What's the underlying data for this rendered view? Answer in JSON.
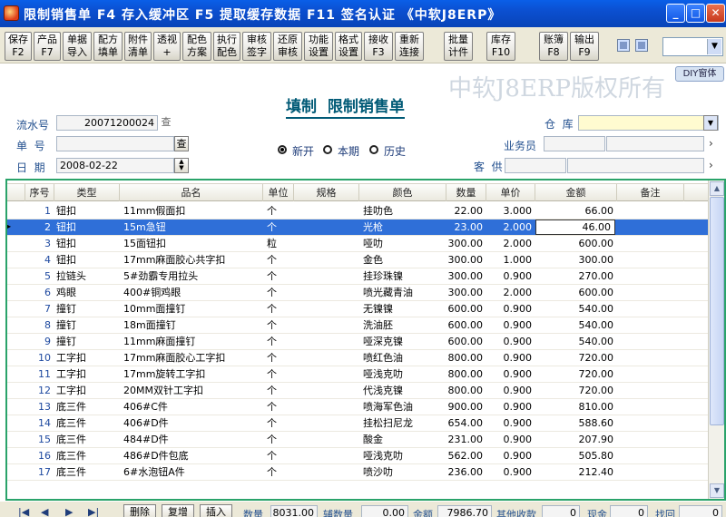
{
  "window": {
    "title": "限制销售单  F4 存入缓冲区  F5 提取缓存数据  F11 签名认证  《中软J8ERP》",
    "min_label": "_",
    "max_label": "□",
    "close_label": "✕"
  },
  "toolbar": {
    "buttons": [
      {
        "name": "save",
        "label": "保存\nF2"
      },
      {
        "name": "product",
        "label": "产品\nF7"
      },
      {
        "name": "doc-import",
        "label": "单据\n导入"
      },
      {
        "name": "fill-color",
        "label": "配方\n填单"
      },
      {
        "name": "attachment",
        "label": "附件\n清单"
      },
      {
        "name": "perspective",
        "label": "透视\n+"
      },
      {
        "name": "color-scheme",
        "label": "配色\n方案"
      },
      {
        "name": "execute-color",
        "label": "执行\n配色"
      },
      {
        "name": "review-sign",
        "label": "审核\n签字"
      },
      {
        "name": "restore-review",
        "label": "还原\n审核"
      },
      {
        "name": "function-settings",
        "label": "功能\n设置"
      },
      {
        "name": "format-settings",
        "label": "格式\n设置"
      },
      {
        "name": "receive",
        "label": "接收\nF3"
      },
      {
        "name": "reconnect",
        "label": "重新\n连接"
      },
      {
        "name": "batch-count",
        "label": "批量\n计件"
      },
      {
        "name": "stock",
        "label": "库存\nF10"
      },
      {
        "name": "ledger",
        "label": "账簿\nF8"
      },
      {
        "name": "export",
        "label": "输出\nF9"
      }
    ],
    "select_value": ""
  },
  "header": {
    "watermark": "中软J8ERP版权所有",
    "diy_label": "DIY窗体",
    "form_title": "填制  限制销售单",
    "serial_label": "流水号",
    "serial_value": "20071200024",
    "serial_btn": "查",
    "docno_label": "单  号",
    "docno_value": "",
    "docno_btn": "查",
    "date_label": "日  期",
    "date_value": "2008-02-22",
    "radio_new": "新开",
    "radio_period": "本期",
    "radio_history": "历史",
    "warehouse_label": "仓  库",
    "warehouse_value": "",
    "salesman_label": "业务员",
    "customer_label": "客  供"
  },
  "grid": {
    "columns": [
      "序号",
      "类型",
      "品名",
      "单位",
      "规格",
      "颜色",
      "数量",
      "单价",
      "金额",
      "备注"
    ],
    "rows": [
      {
        "idx": "1",
        "type": "钮扣",
        "name": "11mm假面扣",
        "unit": "个",
        "spec": "",
        "color": "挂叻色",
        "qty": "22.00",
        "price": "3.000",
        "amount": "66.00",
        "note": ""
      },
      {
        "idx": "2",
        "type": "钮扣",
        "name": "15m急钮",
        "unit": "个",
        "spec": "",
        "color": "光枪",
        "qty": "23.00",
        "price": "2.000",
        "amount": "46.00",
        "note": ""
      },
      {
        "idx": "3",
        "type": "钮扣",
        "name": "15面钮扣",
        "unit": "粒",
        "spec": "",
        "color": "哑叻",
        "qty": "300.00",
        "price": "2.000",
        "amount": "600.00",
        "note": ""
      },
      {
        "idx": "4",
        "type": "钮扣",
        "name": "17mm麻面胶心共字扣",
        "unit": "个",
        "spec": "",
        "color": "金色",
        "qty": "300.00",
        "price": "1.000",
        "amount": "300.00",
        "note": ""
      },
      {
        "idx": "5",
        "type": "拉链头",
        "name": "5#劲霸专用拉头",
        "unit": "个",
        "spec": "",
        "color": "挂珍珠镍",
        "qty": "300.00",
        "price": "0.900",
        "amount": "270.00",
        "note": ""
      },
      {
        "idx": "6",
        "type": "鸡眼",
        "name": "400#铜鸡眼",
        "unit": "个",
        "spec": "",
        "color": "喷光藏青油",
        "qty": "300.00",
        "price": "2.000",
        "amount": "600.00",
        "note": ""
      },
      {
        "idx": "7",
        "type": "撞钉",
        "name": "10mm面撞钉",
        "unit": "个",
        "spec": "",
        "color": "无镍镍",
        "qty": "600.00",
        "price": "0.900",
        "amount": "540.00",
        "note": ""
      },
      {
        "idx": "8",
        "type": "撞钉",
        "name": "18m面撞钉",
        "unit": "个",
        "spec": "",
        "color": "洗油胚",
        "qty": "600.00",
        "price": "0.900",
        "amount": "540.00",
        "note": ""
      },
      {
        "idx": "9",
        "type": "撞钉",
        "name": "11mm麻面撞钉",
        "unit": "个",
        "spec": "",
        "color": "哑深克镍",
        "qty": "600.00",
        "price": "0.900",
        "amount": "540.00",
        "note": ""
      },
      {
        "idx": "10",
        "type": "工字扣",
        "name": "17mm麻面胶心工字扣",
        "unit": "个",
        "spec": "",
        "color": "喷红色油",
        "qty": "800.00",
        "price": "0.900",
        "amount": "720.00",
        "note": ""
      },
      {
        "idx": "11",
        "type": "工字扣",
        "name": "17mm旋转工字扣",
        "unit": "个",
        "spec": "",
        "color": "哑浅克叻",
        "qty": "800.00",
        "price": "0.900",
        "amount": "720.00",
        "note": ""
      },
      {
        "idx": "12",
        "type": "工字扣",
        "name": "20MM双针工字扣",
        "unit": "个",
        "spec": "",
        "color": "代浅克镍",
        "qty": "800.00",
        "price": "0.900",
        "amount": "720.00",
        "note": ""
      },
      {
        "idx": "13",
        "type": "底三件",
        "name": "406#C件",
        "unit": "个",
        "spec": "",
        "color": "喷海军色油",
        "qty": "900.00",
        "price": "0.900",
        "amount": "810.00",
        "note": ""
      },
      {
        "idx": "14",
        "type": "底三件",
        "name": "406#D件",
        "unit": "个",
        "spec": "",
        "color": "挂松扫尼龙",
        "qty": "654.00",
        "price": "0.900",
        "amount": "588.60",
        "note": ""
      },
      {
        "idx": "15",
        "type": "底三件",
        "name": "484#D件",
        "unit": "个",
        "spec": "",
        "color": "酸金",
        "qty": "231.00",
        "price": "0.900",
        "amount": "207.90",
        "note": ""
      },
      {
        "idx": "16",
        "type": "底三件",
        "name": "486#D件包底",
        "unit": "个",
        "spec": "",
        "color": "哑浅克叻",
        "qty": "562.00",
        "price": "0.900",
        "amount": "505.80",
        "note": ""
      },
      {
        "idx": "17",
        "type": "底三件",
        "name": "6#水泡钮A件",
        "unit": "个",
        "spec": "",
        "color": "喷沙叻",
        "qty": "236.00",
        "price": "0.900",
        "amount": "212.40",
        "note": ""
      }
    ],
    "selected_row": 1
  },
  "footer": {
    "delete_label": "删除",
    "copy_label": "复增",
    "insert_label": "插入",
    "qty_label": "数量",
    "qty_value": "8031.00",
    "aux_qty_label": "辅数量",
    "aux_qty_value": "0.00",
    "amount_label": "金额",
    "amount_value": "7986.70",
    "other_label": "其他收款",
    "other_value": "0",
    "cash_label": "现金",
    "cash_value": "0",
    "back_label": "找回",
    "back_value": "0"
  },
  "colors": {
    "titlebar": "#0b4fd0",
    "selection": "#2f6fd8",
    "grid_border": "#2aa36a",
    "form_title": "#005a76",
    "label": "#23508f"
  }
}
